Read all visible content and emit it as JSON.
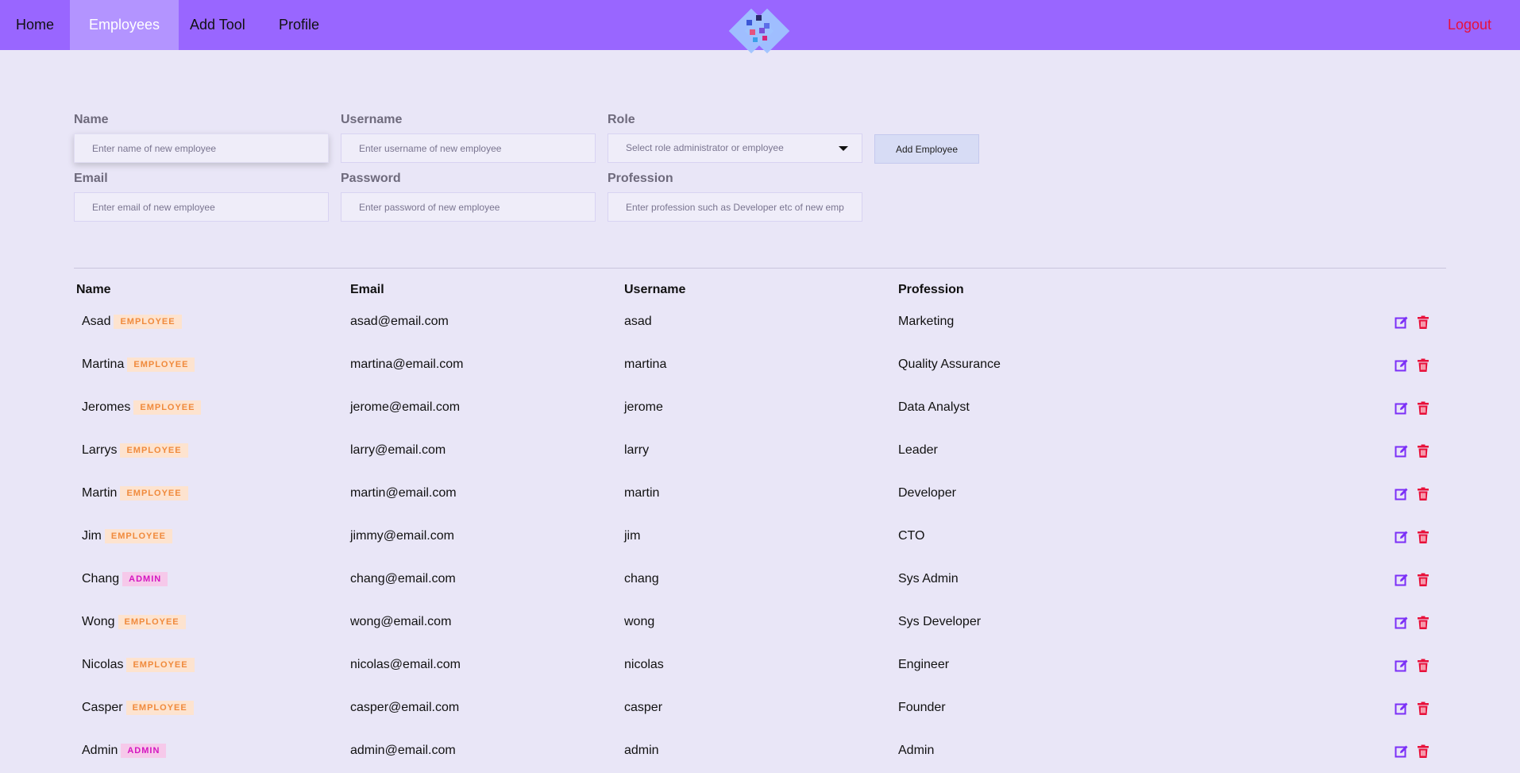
{
  "nav": {
    "home": "Home",
    "employees": "Employees",
    "add_tool": "Add Tool",
    "profile": "Profile",
    "logout": "Logout"
  },
  "colors": {
    "navbar": "#9966ff",
    "active_tab": "#b394ff",
    "logout": "#e8103a",
    "edit_icon": "#7b2ff7",
    "delete_icon": "#e8103a"
  },
  "form": {
    "name": {
      "label": "Name",
      "placeholder": "Enter name of new employee"
    },
    "username": {
      "label": "Username",
      "placeholder": "Enter username of new employee"
    },
    "role": {
      "label": "Role",
      "placeholder": "Select role administrator or employee"
    },
    "email": {
      "label": "Email",
      "placeholder": "Enter email of new employee"
    },
    "password": {
      "label": "Password",
      "placeholder": "Enter password of new employee"
    },
    "profession": {
      "label": "Profession",
      "placeholder": "Enter profession such as Developer etc of new employee"
    },
    "submit_label": "Add Employee"
  },
  "table": {
    "headers": {
      "name": "Name",
      "email": "Email",
      "username": "Username",
      "profession": "Profession"
    },
    "rows": [
      {
        "name": "Asad",
        "role": "EMPLOYEE",
        "email": "asad@email.com",
        "username": "asad",
        "profession": "Marketing"
      },
      {
        "name": "Martina",
        "role": "EMPLOYEE",
        "email": "martina@email.com",
        "username": "martina",
        "profession": "Quality Assurance"
      },
      {
        "name": "Jeromes",
        "role": "EMPLOYEE",
        "email": "jerome@email.com",
        "username": "jerome",
        "profession": "Data Analyst"
      },
      {
        "name": "Larrys",
        "role": "EMPLOYEE",
        "email": "larry@email.com",
        "username": "larry",
        "profession": "Leader"
      },
      {
        "name": "Martin",
        "role": "EMPLOYEE",
        "email": "martin@email.com",
        "username": "martin",
        "profession": "Developer"
      },
      {
        "name": "Jim",
        "role": "EMPLOYEE",
        "email": "jimmy@email.com",
        "username": "jim",
        "profession": "CTO"
      },
      {
        "name": "Chang",
        "role": "ADMIN",
        "email": "chang@email.com",
        "username": "chang",
        "profession": "Sys Admin"
      },
      {
        "name": "Wong",
        "role": "EMPLOYEE",
        "email": "wong@email.com",
        "username": "wong",
        "profession": "Sys Developer"
      },
      {
        "name": "Nicolas",
        "role": "EMPLOYEE",
        "email": "nicolas@email.com",
        "username": "nicolas",
        "profession": "Engineer"
      },
      {
        "name": "Casper",
        "role": "EMPLOYEE",
        "email": "casper@email.com",
        "username": "casper",
        "profession": "Founder"
      },
      {
        "name": "Admin",
        "role": "ADMIN",
        "email": "admin@email.com",
        "username": "admin",
        "profession": "Admin"
      }
    ]
  }
}
